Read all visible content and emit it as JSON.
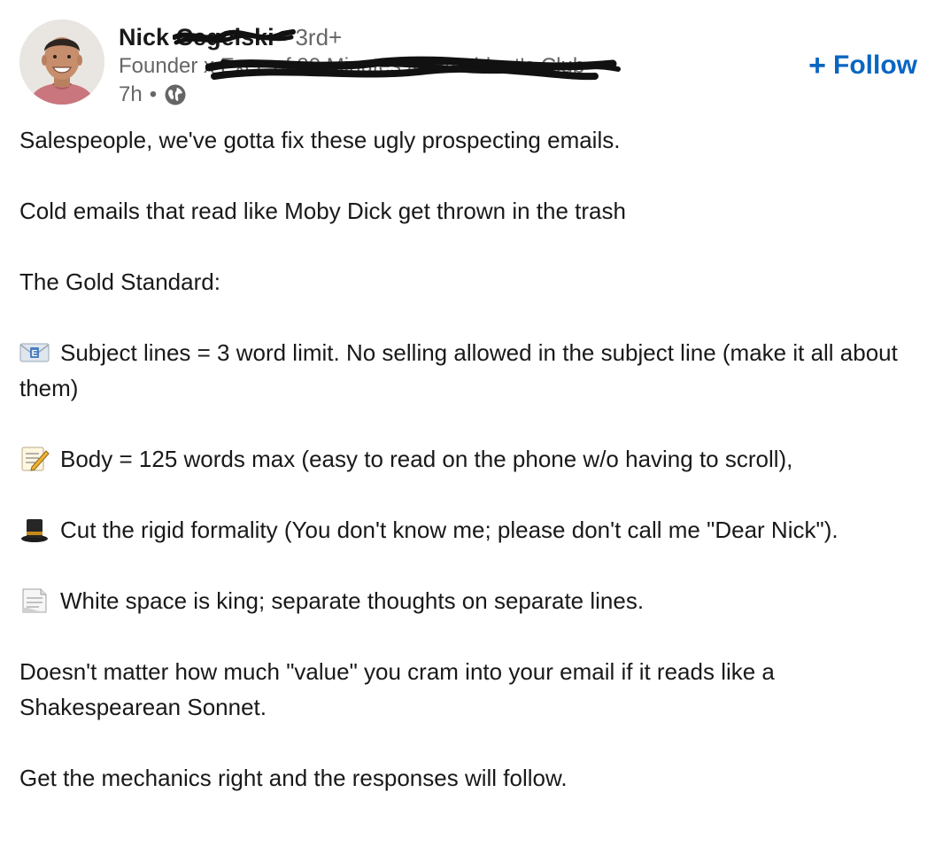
{
  "author": {
    "first_name": "Nick",
    "last_name_redacted": "Cegelski",
    "degree": "3rd+",
    "headline": "Founder x Exec of 30 Minutes to President's Club",
    "time": "7h",
    "separator": "•",
    "visibility_icon": "globe-icon"
  },
  "actions": {
    "follow_label": "Follow",
    "follow_icon": "plus-icon"
  },
  "colors": {
    "accent": "#0a66c2",
    "text_primary": "#191919",
    "text_secondary": "#666666"
  },
  "post": {
    "p1": "Salespeople, we've gotta fix these ugly prospecting emails.",
    "p2": "Cold emails that read like Moby Dick get thrown in the trash",
    "p3": "The Gold Standard:",
    "p4_icon": "email-icon",
    "p4": "Subject lines = 3 word limit. No selling allowed in the subject line (make it all about them)",
    "p5_icon": "memo-icon",
    "p5": "Body = 125 words max (easy to read on the phone w/o having to scroll),",
    "p6_icon": "top-hat-icon",
    "p6": "Cut the rigid formality (You don't know me; please don't call me \"Dear Nick\").",
    "p7_icon": "page-icon",
    "p7": "White space is king; separate thoughts on separate lines.",
    "p8": "Doesn't matter how much \"value\" you cram into your email if it reads like a Shakespearean Sonnet.",
    "p9": "Get the mechanics right and the responses will follow."
  }
}
